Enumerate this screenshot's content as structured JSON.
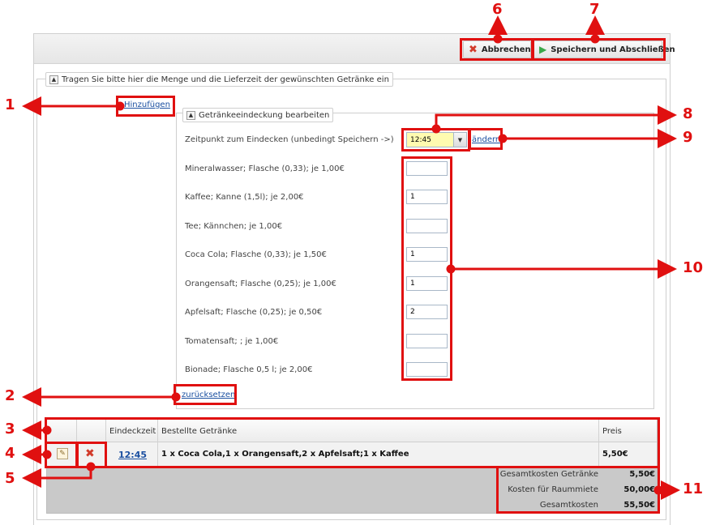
{
  "toolbar": {
    "cancel_label": "Abbrechen",
    "save_label": "Speichern und Abschließen"
  },
  "outer_section": {
    "legend": "Tragen Sie bitte hier die Menge und die Lieferzeit der gewünschten Getränke ein",
    "add_link": "Hinzufügen",
    "reset_link": "zurücksetzen"
  },
  "inner_section": {
    "legend": "Getränkeeindeckung bearbeiten",
    "time_label": "Zeitpunkt zum Eindecken (unbedingt Speichern ->)",
    "time_value": "12:45",
    "change_link": "ändern",
    "drinks": [
      {
        "label": "Mineralwasser; Flasche (0,33); je 1,00€",
        "qty": ""
      },
      {
        "label": "Kaffee; Kanne (1,5l); je 2,00€",
        "qty": "1"
      },
      {
        "label": "Tee; Kännchen; je 1,00€",
        "qty": ""
      },
      {
        "label": "Coca Cola; Flasche (0,33); je 1,50€",
        "qty": "1"
      },
      {
        "label": "Orangensaft; Flasche (0,25); je 1,00€",
        "qty": "1"
      },
      {
        "label": "Apfelsaft; Flasche (0,25); je 0,50€",
        "qty": "2"
      },
      {
        "label": "Tomatensaft; ; je 1,00€",
        "qty": ""
      },
      {
        "label": "Bionade; Flasche 0,5 l; je 2,00€",
        "qty": ""
      }
    ]
  },
  "grid": {
    "headers": [
      "Eindeckzeit",
      "Bestellte Getränke",
      "Preis"
    ],
    "row": {
      "time": "12:45",
      "drinks": "1 x Coca Cola,1 x Orangensaft,2 x Apfelsaft;1 x Kaffee",
      "price": "5,50€"
    },
    "summary": [
      {
        "label": "Gesamtkosten Getränke",
        "value": "5,50€"
      },
      {
        "label": "Kosten für Raummiete",
        "value": "50,00€"
      },
      {
        "label": "Gesamtkosten",
        "value": "55,50€"
      }
    ]
  },
  "annotations": [
    "1",
    "2",
    "3",
    "4",
    "5",
    "6",
    "7",
    "8",
    "9",
    "10",
    "11"
  ],
  "colors": {
    "annotation": "#e01010",
    "link": "#1a4fa0",
    "time_field_bg": "#fffbb0"
  }
}
